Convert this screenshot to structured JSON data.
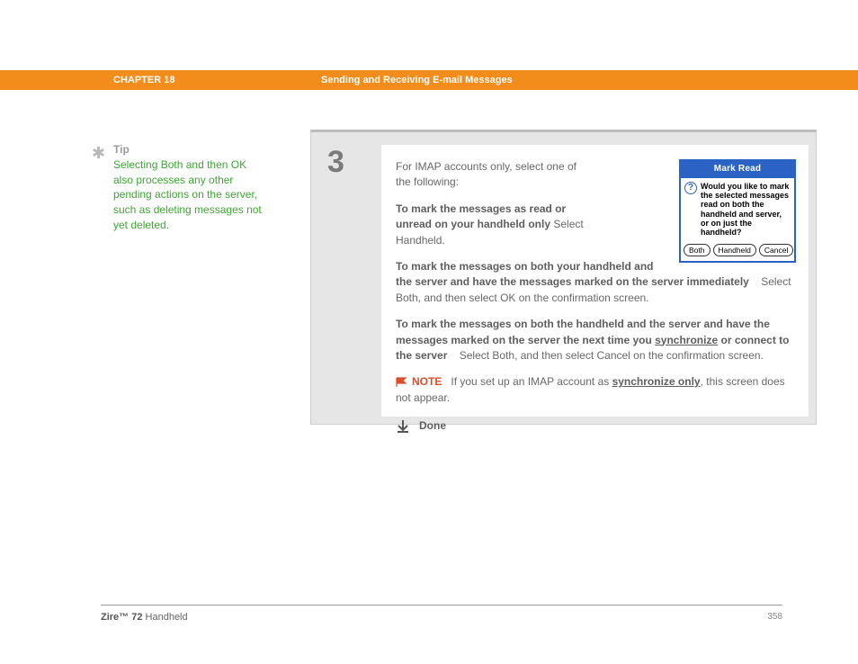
{
  "header": {
    "chapter": "CHAPTER 18",
    "title": "Sending and Receiving E-mail Messages"
  },
  "tip": {
    "heading": "Tip",
    "text": "Selecting Both and then OK also processes any other pending actions on the server, such as deleting messages not yet deleted."
  },
  "step": {
    "number": "3",
    "intro": "For IMAP accounts only, select one of the following:",
    "opt1_bold": "To mark the messages as read or unread on your handheld only",
    "opt1_tail": "Select Handheld.",
    "opt2_bold": "To mark the messages on both your handheld and the server and have the messages marked on the server immediately",
    "opt2_tail": "Select Both, and then select OK on the confirmation screen.",
    "opt3_pre": "To mark the messages on both the handheld and the server and have the messages marked on the server the next time you ",
    "opt3_link": "synchronize",
    "opt3_post": " or connect to the server",
    "opt3_tail": "Select Both, and then select Cancel on the confirmation screen.",
    "note_label": "NOTE",
    "note_pre": "If you set up an IMAP account as ",
    "note_link": "synchronize only",
    "note_post": ", this screen does not appear.",
    "done": "Done"
  },
  "dialog": {
    "title": "Mark Read",
    "message": "Would you like to mark the selected messages read on both the handheld and server, or on just the handheld?",
    "btn1": "Both",
    "btn2": "Handheld",
    "btn3": "Cancel"
  },
  "footer": {
    "product_bold": "Zire™ 72",
    "product_tail": " Handheld",
    "page": "358"
  }
}
